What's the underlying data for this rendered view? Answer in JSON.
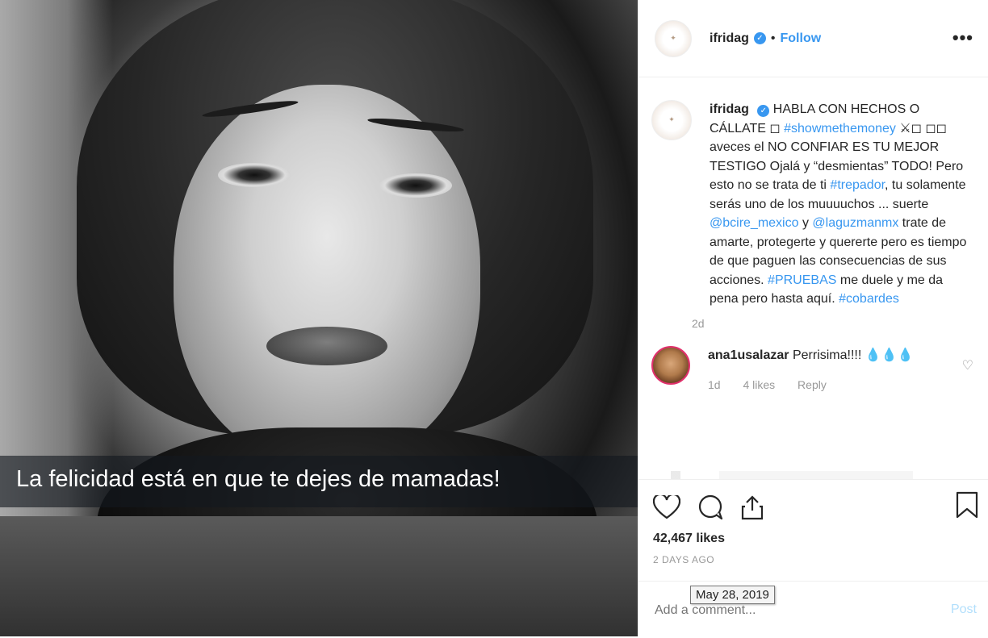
{
  "photo": {
    "caption": "La felicidad está en que te dejes de mamadas!"
  },
  "header": {
    "username": "ifridag",
    "separator": "•",
    "follow_label": "Follow",
    "more_icon": "more-horizontal-icon"
  },
  "caption": {
    "username": "ifridag",
    "text_parts": [
      {
        "t": "HABLA CON HECHOS O CÁLLATE ◻ ",
        "tag": false
      },
      {
        "t": "#showmethemoney",
        "tag": true
      },
      {
        "t": " ⚔◻ ◻◻ aveces el NO CONFIAR ES TU MEJOR TESTIGO Ojalá y “desmientas” TODO! Pero esto no se trata de ti ",
        "tag": false
      },
      {
        "t": "#trepador",
        "tag": true
      },
      {
        "t": ", tu solamente serás uno de los muuuuchos ... suerte ",
        "tag": false
      },
      {
        "t": "@bcire_mexico",
        "tag": true
      },
      {
        "t": " y ",
        "tag": false
      },
      {
        "t": "@laguzmanmx",
        "tag": true
      },
      {
        "t": " trate de amarte, protegerte y quererte pero es tiempo de que paguen las consecuencias de sus acciones. ",
        "tag": false
      },
      {
        "t": "#PRUEBAS",
        "tag": true
      },
      {
        "t": " me duele y me da pena pero hasta aquí. ",
        "tag": false
      },
      {
        "t": "#cobardes",
        "tag": true
      }
    ],
    "age": "2d"
  },
  "comment": {
    "username": "ana1usalazar",
    "text": "Perrisima!!!! 💧💧💧",
    "age": "1d",
    "likes": "4 likes",
    "reply": "Reply"
  },
  "actions": {
    "likes": "42,467 likes",
    "ago": "2 DAYS AGO",
    "tooltip": "May 28, 2019",
    "add_placeholder": "Add a comment...",
    "post_label": "Post"
  },
  "colors": {
    "accent": "#3897f0",
    "muted": "#999999",
    "post_disabled": "#b2dffc"
  }
}
